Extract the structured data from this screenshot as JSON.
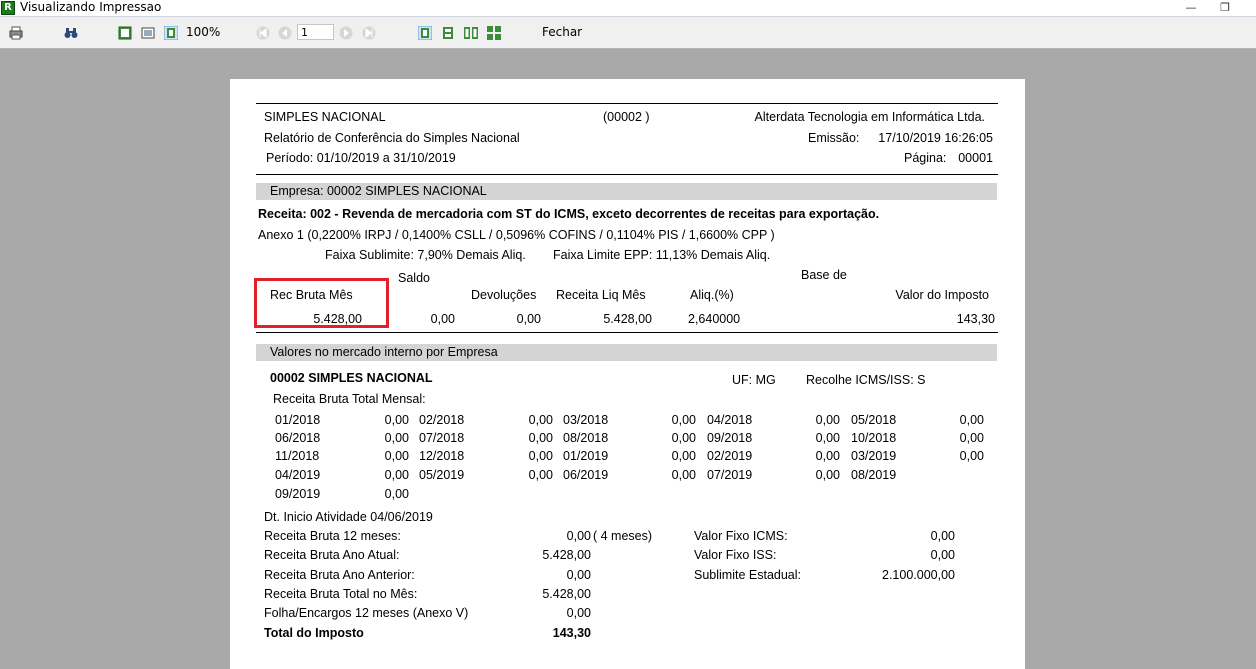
{
  "window": {
    "title": "Visualizando Impressao",
    "icon_letter": "R"
  },
  "toolbar": {
    "zoom": "100%",
    "page_input": "1",
    "close_label": "Fechar"
  },
  "report": {
    "header": {
      "title": "SIMPLES NACIONAL",
      "code": "(00002 )",
      "company_name": "Alterdata Tecnologia em Informática Ltda.",
      "subtitle": "Relatório de Conferência do Simples Nacional",
      "emission_label": "Emissão:",
      "emission_value": "17/10/2019 16:26:05",
      "period": "Período:  01/10/2019 a 31/10/2019",
      "page_label": "Página:",
      "page_value": "00001"
    },
    "empresa_bar": "Empresa:  00002 SIMPLES NACIONAL",
    "receita_line": "Receita: 002 - Revenda de mercadoria com ST do ICMS, exceto decorrentes de receitas para exportação.",
    "anexo_line": "Anexo    1  (0,2200% IRPJ  / 0,1400% CSLL / 0,5096% COFINS / 0,1104% PIS  / 1,6600% CPP )",
    "faixa_sublimite": "Faixa Sublimite: 7,90% Demais Aliq.",
    "faixa_limite": "Faixa Limite EPP: 11,13% Demais Aliq.",
    "columns": {
      "saldo": "Saldo",
      "base_de": "Base de",
      "rec_bruta_mes": "Rec Bruta Mês",
      "devolucoes": "Devoluções",
      "receita_liq_mes": "Receita Liq Mês",
      "aliq": "Aliq.(%)",
      "valor_imposto": "Valor do Imposto"
    },
    "values": {
      "rec_bruta_mes": "5.428,00",
      "saldo": "0,00",
      "devolucoes": "0,00",
      "receita_liq_mes": "5.428,00",
      "aliq": "2,640000",
      "valor_imposto": "143,30"
    },
    "mercado_bar": "Valores no mercado interno por Empresa",
    "empresa_name": "00002  SIMPLES NACIONAL",
    "uf": "UF: MG",
    "recolhe": "Recolhe ICMS/ISS:  S",
    "receita_bruta_total_mensal": "Receita Bruta Total Mensal:",
    "monthly": [
      [
        [
          "01/2018",
          "0,00"
        ],
        [
          "02/2018",
          "0,00"
        ],
        [
          "03/2018",
          "0,00"
        ],
        [
          "04/2018",
          "0,00"
        ],
        [
          "05/2018",
          "0,00"
        ]
      ],
      [
        [
          "06/2018",
          "0,00"
        ],
        [
          "07/2018",
          "0,00"
        ],
        [
          "08/2018",
          "0,00"
        ],
        [
          "09/2018",
          "0,00"
        ],
        [
          "10/2018",
          "0,00"
        ]
      ],
      [
        [
          "11/2018",
          "0,00"
        ],
        [
          "12/2018",
          "0,00"
        ],
        [
          "01/2019",
          "0,00"
        ],
        [
          "02/2019",
          "0,00"
        ],
        [
          "03/2019",
          "0,00"
        ]
      ],
      [
        [
          "04/2019",
          "0,00"
        ],
        [
          "05/2019",
          "0,00"
        ],
        [
          "06/2019",
          "0,00"
        ],
        [
          "07/2019",
          "0,00"
        ],
        [
          "08/2019",
          ""
        ]
      ],
      [
        [
          "09/2019",
          "0,00"
        ]
      ]
    ],
    "dt_inicio": "Dt. Inicio Atividade  04/06/2019",
    "summary_left": [
      [
        "Receita Bruta 12 meses:",
        "0,00"
      ],
      [
        "Receita Bruta Ano Atual:",
        "5.428,00"
      ],
      [
        "Receita Bruta Ano Anterior:",
        "0,00"
      ],
      [
        "Receita Bruta Total no Mês:",
        "5.428,00"
      ],
      [
        "Folha/Encargos 12 meses (Anexo V)",
        "0,00"
      ],
      [
        "Total do Imposto",
        "143,30"
      ]
    ],
    "meses_note": "( 4   meses)",
    "summary_right": [
      [
        "Valor Fixo ICMS:",
        "0,00"
      ],
      [
        "Valor Fixo ISS:",
        "0,00"
      ],
      [
        "Sublimite Estadual:",
        "2.100.000,00"
      ]
    ]
  }
}
